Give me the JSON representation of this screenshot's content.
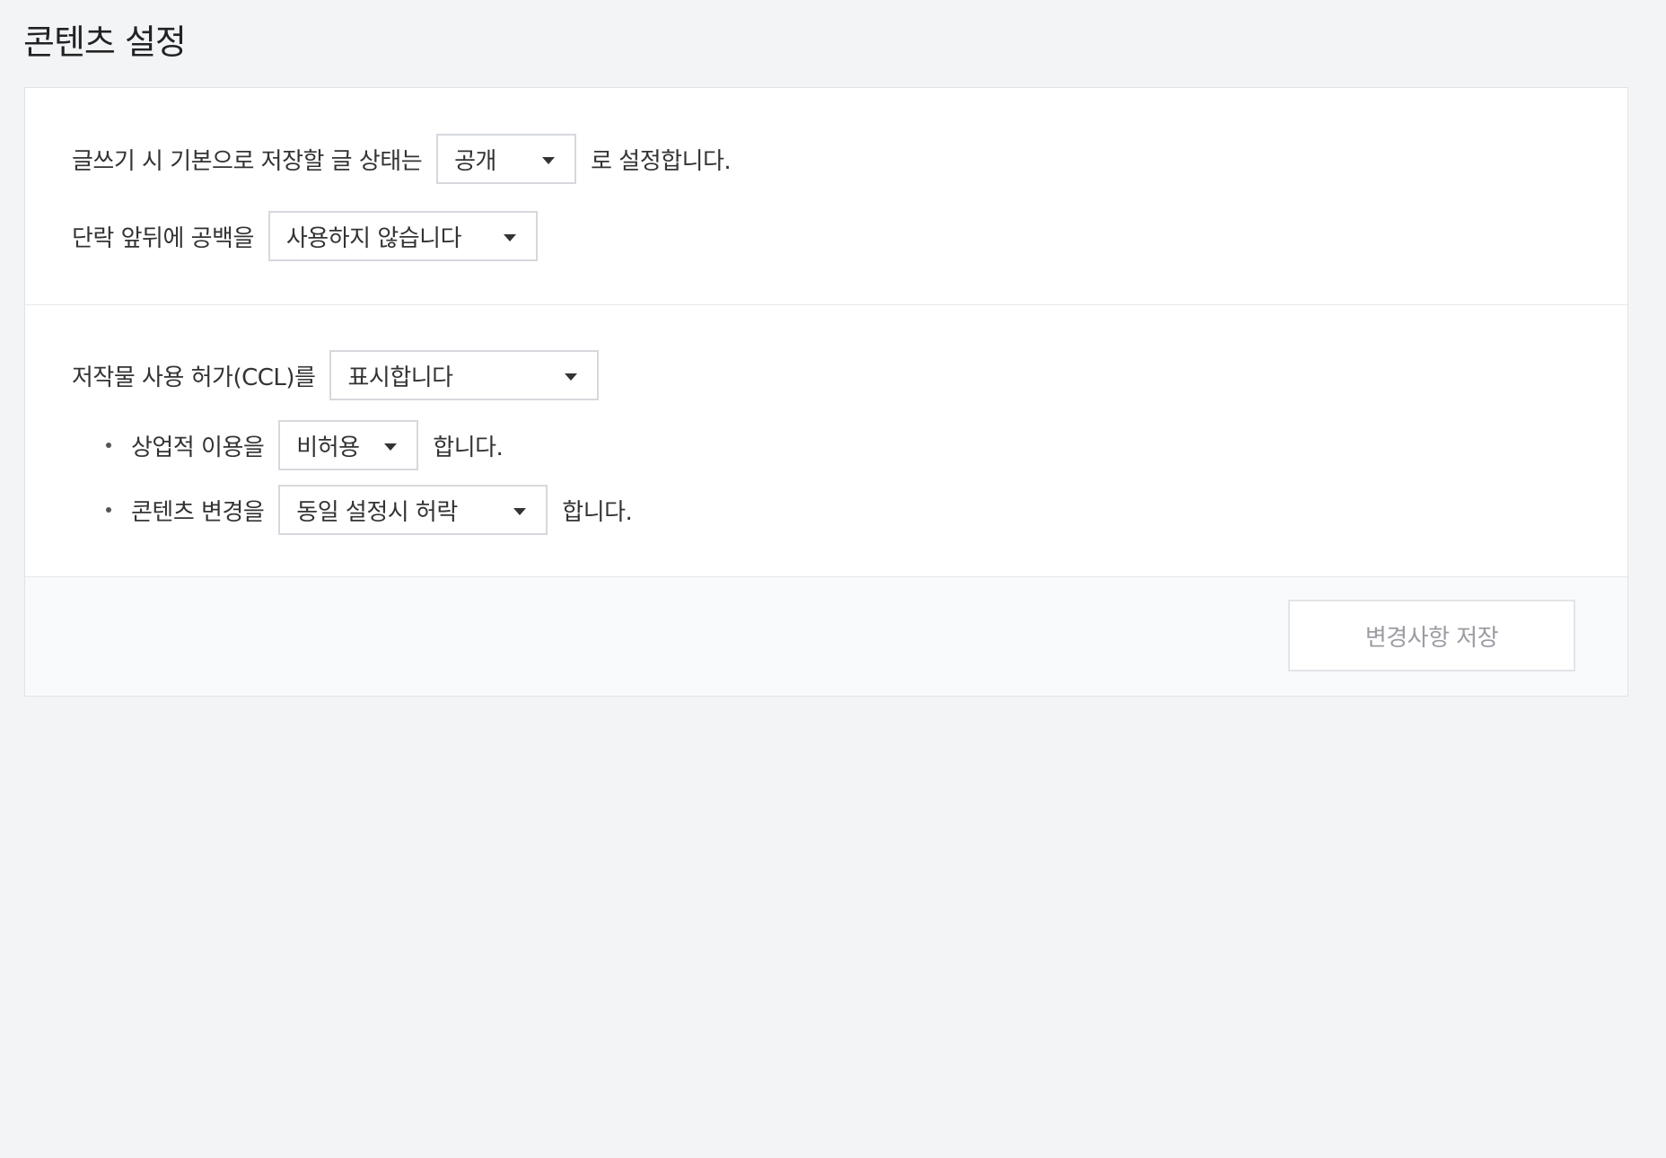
{
  "page": {
    "title": "콘텐츠 설정"
  },
  "post_status": {
    "prefix": "글쓰기 시 기본으로 저장할 글 상태는",
    "selected": "공개",
    "suffix": "로 설정합니다."
  },
  "paragraph_spacing": {
    "prefix": "단락 앞뒤에 공백을",
    "selected": "사용하지 않습니다"
  },
  "ccl": {
    "prefix": "저작물 사용 허가(CCL)를",
    "selected": "표시합니다",
    "commercial": {
      "prefix": "상업적 이용을",
      "selected": "비허용",
      "suffix": "합니다."
    },
    "modification": {
      "prefix": "콘텐츠 변경을",
      "selected": "동일 설정시 허락",
      "suffix": "합니다."
    }
  },
  "footer": {
    "save_label": "변경사항 저장"
  },
  "icons": {
    "dropdown": "caret-down-icon",
    "bullet": "bullet-dot-icon"
  },
  "colors": {
    "background": "#f3f4f6",
    "panel": "#ffffff",
    "border": "#d6d8dd",
    "text": "#333333",
    "button_text_disabled": "#9a9ca2"
  }
}
